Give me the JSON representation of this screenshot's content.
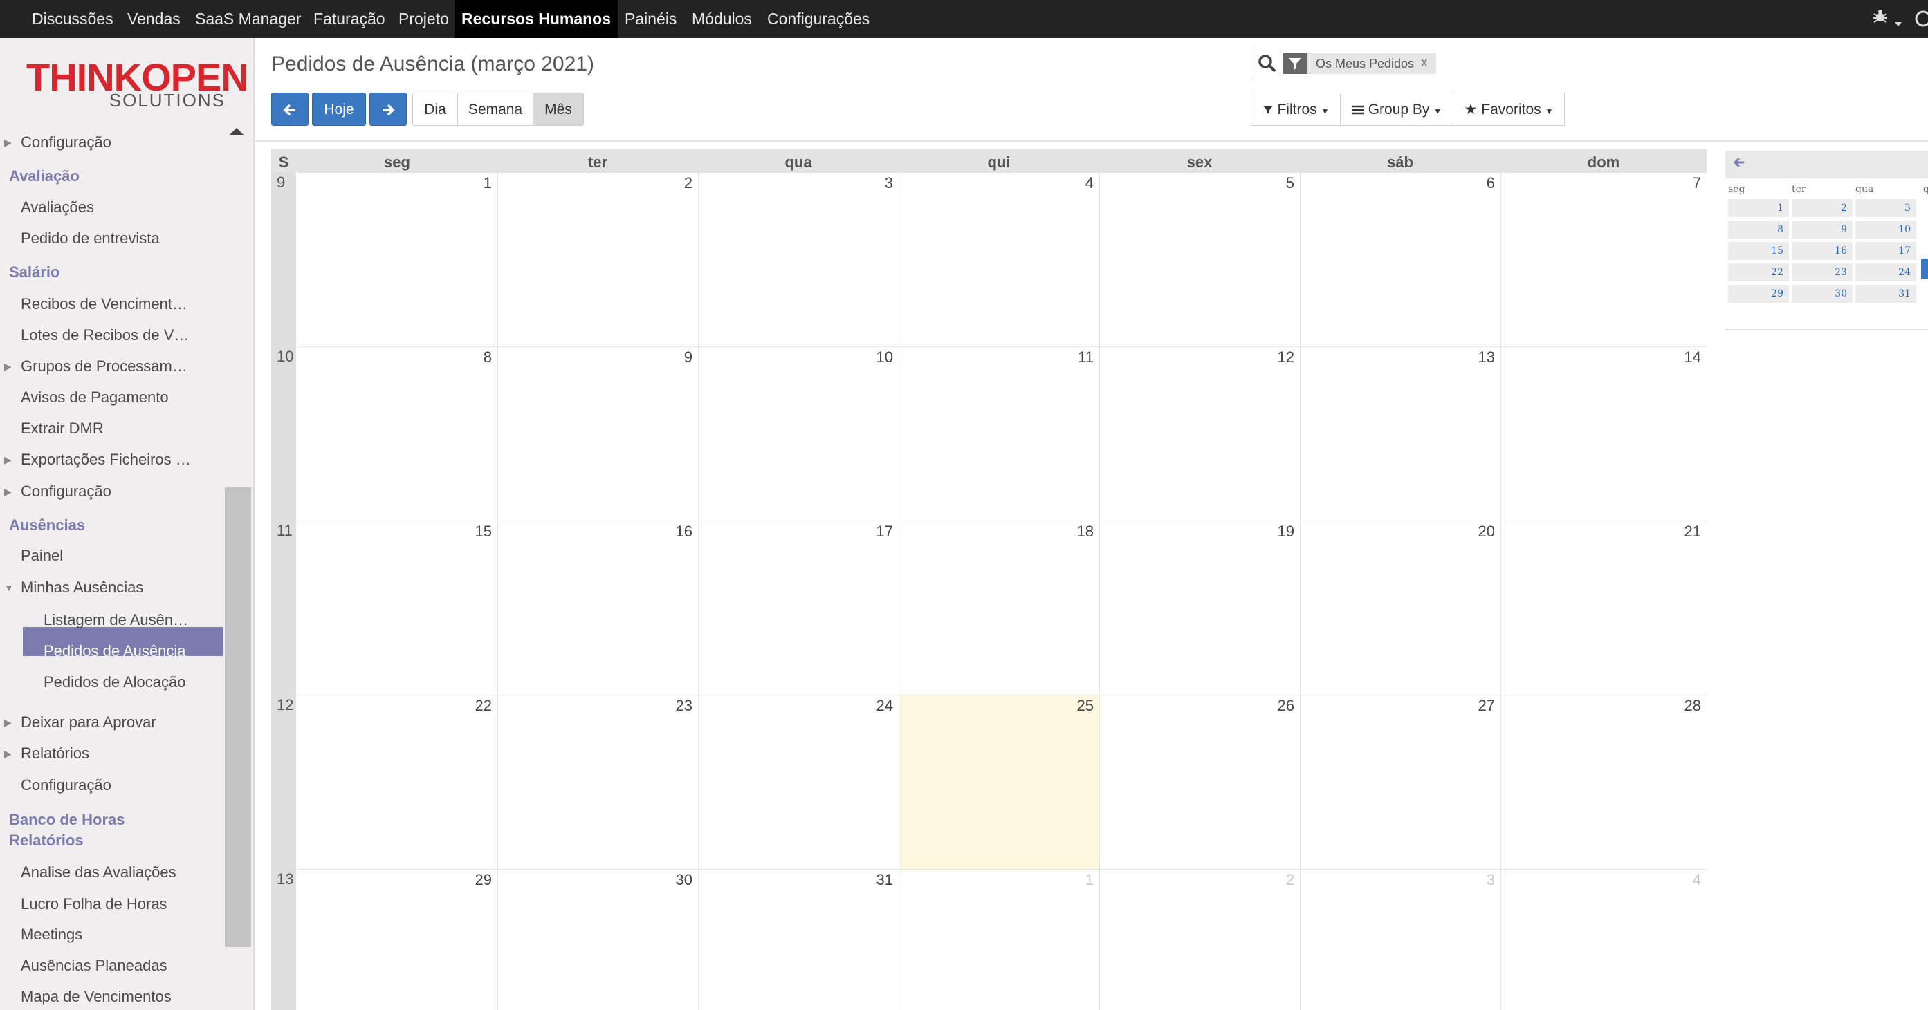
{
  "topbar": {
    "menu": [
      "Discussões",
      "Vendas",
      "SaaS Manager",
      "Faturação",
      "Projeto",
      "Recursos Humanos",
      "Painéis",
      "Módulos",
      "Configurações"
    ],
    "active": "Recursos Humanos"
  },
  "logo": {
    "main": "THINKOPEN",
    "sub": "SOLUTIONS"
  },
  "sidebar": {
    "items": [
      {
        "text": "Configuração",
        "type": "item"
      },
      {
        "text": "Avaliação",
        "type": "head"
      },
      {
        "text": "Avaliações",
        "type": "item"
      },
      {
        "text": "Pedido de entrevista",
        "type": "item"
      },
      {
        "text": "Salário",
        "type": "head"
      },
      {
        "text": "Recibos de Venciment…",
        "type": "item"
      },
      {
        "text": "Lotes de Recibos de V…",
        "type": "item"
      },
      {
        "text": "Grupos de Processam…",
        "type": "item"
      },
      {
        "text": "Avisos de Pagamento",
        "type": "item"
      },
      {
        "text": "Extrair DMR",
        "type": "item"
      },
      {
        "text": "Exportações Ficheiros …",
        "type": "item"
      },
      {
        "text": "Configuração",
        "type": "item"
      },
      {
        "text": "Ausências",
        "type": "head"
      },
      {
        "text": "Painel",
        "type": "item"
      },
      {
        "text": "Minhas Ausências",
        "type": "item"
      },
      {
        "text": "Listagem de Ausên…",
        "type": "sub"
      },
      {
        "text": "Pedidos de Ausência",
        "type": "sub-active"
      },
      {
        "text": "Pedidos de Alocação",
        "type": "sub"
      },
      {
        "text": "Deixar para Aprovar",
        "type": "item"
      },
      {
        "text": "Relatórios",
        "type": "item"
      },
      {
        "text": "Configuração",
        "type": "item"
      },
      {
        "text": "Banco de Horas",
        "type": "head"
      },
      {
        "text": "Relatórios",
        "type": "head"
      },
      {
        "text": "Analise das Avaliações",
        "type": "item"
      },
      {
        "text": "Lucro Folha de Horas",
        "type": "item"
      },
      {
        "text": "Meetings",
        "type": "item"
      },
      {
        "text": "Ausências Planeadas",
        "type": "item"
      },
      {
        "text": "Mapa de Vencimentos",
        "type": "item"
      }
    ]
  },
  "page": {
    "title": "Pedidos de Ausência (março 2021)"
  },
  "toolbar": {
    "prev_icon": "arrow-left-icon",
    "today": "Hoje",
    "next_icon": "arrow-right-icon",
    "views": [
      "Dia",
      "Semana",
      "Mês"
    ],
    "active_view": "Mês"
  },
  "search": {
    "facet": "Os Meus Pedidos",
    "facet_close": "x",
    "filters": "Filtros",
    "group_by": "Group By",
    "favorites": "Favoritos"
  },
  "calendar": {
    "week_header": "S",
    "day_names": [
      "seg",
      "ter",
      "qua",
      "qui",
      "sex",
      "sáb",
      "dom"
    ],
    "weeks": [
      {
        "num": "9",
        "days": [
          [
            "1",
            0
          ],
          [
            "2",
            0
          ],
          [
            "3",
            0
          ],
          [
            "4",
            0
          ],
          [
            "5",
            0
          ],
          [
            "6",
            0
          ],
          [
            "7",
            0
          ]
        ]
      },
      {
        "num": "10",
        "days": [
          [
            "8",
            0
          ],
          [
            "9",
            0
          ],
          [
            "10",
            0
          ],
          [
            "11",
            0
          ],
          [
            "12",
            0
          ],
          [
            "13",
            0
          ],
          [
            "14",
            0
          ]
        ]
      },
      {
        "num": "11",
        "days": [
          [
            "15",
            0
          ],
          [
            "16",
            0
          ],
          [
            "17",
            0
          ],
          [
            "18",
            0
          ],
          [
            "19",
            0
          ],
          [
            "20",
            0
          ],
          [
            "21",
            0
          ]
        ]
      },
      {
        "num": "12",
        "days": [
          [
            "22",
            0
          ],
          [
            "23",
            0
          ],
          [
            "24",
            0
          ],
          [
            "25",
            2
          ],
          [
            "26",
            0
          ],
          [
            "27",
            0
          ],
          [
            "28",
            0
          ]
        ]
      },
      {
        "num": "13",
        "days": [
          [
            "29",
            0
          ],
          [
            "30",
            0
          ],
          [
            "31",
            0
          ],
          [
            "1",
            1
          ],
          [
            "2",
            1
          ],
          [
            "3",
            1
          ],
          [
            "4",
            1
          ]
        ]
      }
    ]
  },
  "mini_calendar": {
    "prev_icon": "arrow-left-icon",
    "day_names": [
      "seg",
      "ter",
      "qua",
      "q"
    ],
    "rows": [
      [
        "1",
        "2",
        "3"
      ],
      [
        "8",
        "9",
        "10"
      ],
      [
        "15",
        "16",
        "17"
      ],
      [
        "22",
        "23",
        "24"
      ],
      [
        "29",
        "30",
        "31"
      ]
    ]
  }
}
